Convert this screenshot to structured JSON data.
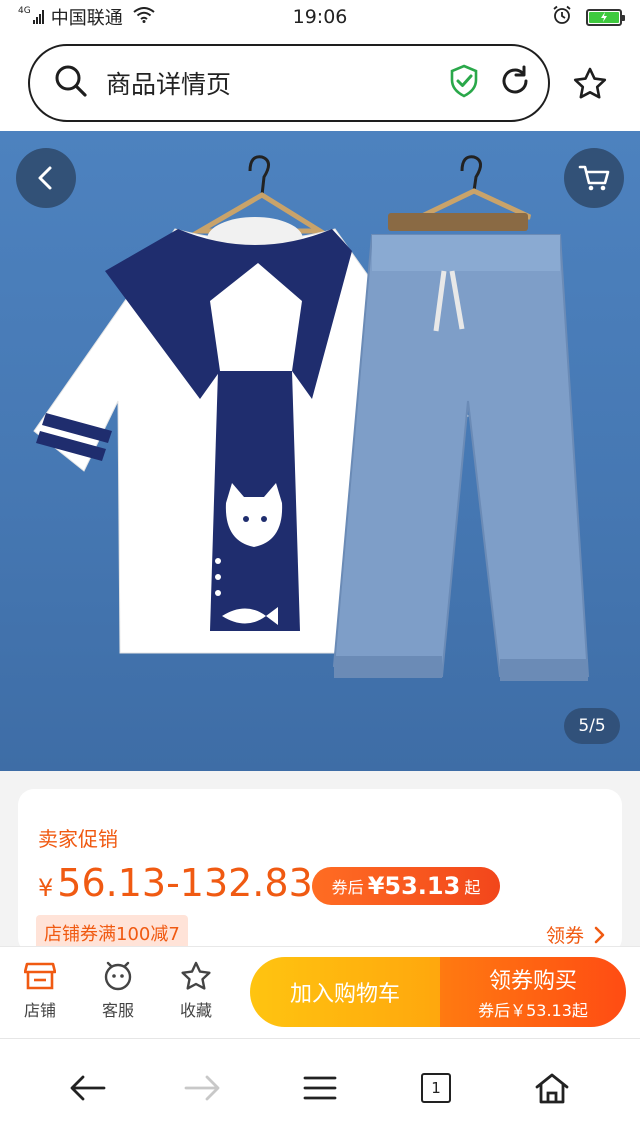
{
  "status_bar": {
    "network_type": "4G",
    "carrier": "中国联通",
    "time": "19:06"
  },
  "address_bar": {
    "title": "商品详情页",
    "icons": [
      "search-icon",
      "shield-check-icon",
      "refresh-icon",
      "star-icon"
    ]
  },
  "gallery": {
    "counter": "5/5",
    "current_index": 5,
    "total": 5
  },
  "price": {
    "promo_label": "卖家促销",
    "currency_symbol": "¥",
    "range": "56.13-132.83",
    "coupon_prefix": "券后",
    "coupon_amount": "¥53.13",
    "coupon_suffix": "起",
    "shop_coupon": "店铺券满100减7",
    "get_coupon": "领券"
  },
  "actions": {
    "shop": "店铺",
    "service": "客服",
    "favorite": "收藏",
    "add_to_cart": "加入购物车",
    "buy_with_coupon": "领券购买",
    "buy_sub": "券后￥53.13起"
  },
  "browser_nav": {
    "tab_count": "1"
  },
  "colors": {
    "accent": "#f05a12",
    "cart_button": "#ffb30f",
    "buy_button": "#ff5a12",
    "image_bg": "#4a7db9",
    "secure_icon": "#2aa84a"
  }
}
